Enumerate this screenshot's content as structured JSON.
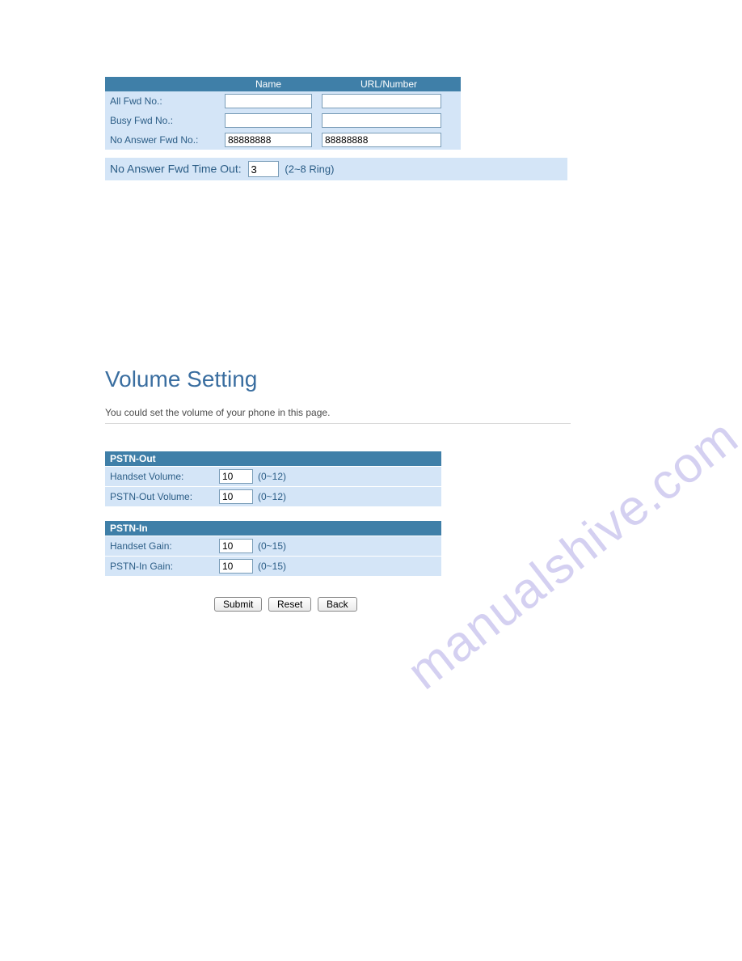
{
  "watermark": "manualshive.com",
  "forward_table": {
    "headers": {
      "name": "Name",
      "url": "URL/Number"
    },
    "rows": [
      {
        "label": "All Fwd No.:",
        "name": "",
        "url": ""
      },
      {
        "label": "Busy Fwd No.:",
        "name": "",
        "url": ""
      },
      {
        "label": "No Answer Fwd No.:",
        "name": "88888888",
        "url": "88888888"
      }
    ],
    "timeout_label": "No Answer Fwd Time Out:",
    "timeout_value": "3",
    "timeout_hint": "(2~8 Ring)"
  },
  "volume": {
    "title": "Volume Setting",
    "description": "You could set the volume of your phone in this page.",
    "sections": [
      {
        "header": "PSTN-Out",
        "rows": [
          {
            "label": "Handset Volume:",
            "value": "10",
            "range": "(0~12)"
          },
          {
            "label": "PSTN-Out Volume:",
            "value": "10",
            "range": "(0~12)"
          }
        ]
      },
      {
        "header": "PSTN-In",
        "rows": [
          {
            "label": "Handset Gain:",
            "value": "10",
            "range": "(0~15)"
          },
          {
            "label": "PSTN-In Gain:",
            "value": "10",
            "range": "(0~15)"
          }
        ]
      }
    ],
    "buttons": {
      "submit": "Submit",
      "reset": "Reset",
      "back": "Back"
    }
  }
}
